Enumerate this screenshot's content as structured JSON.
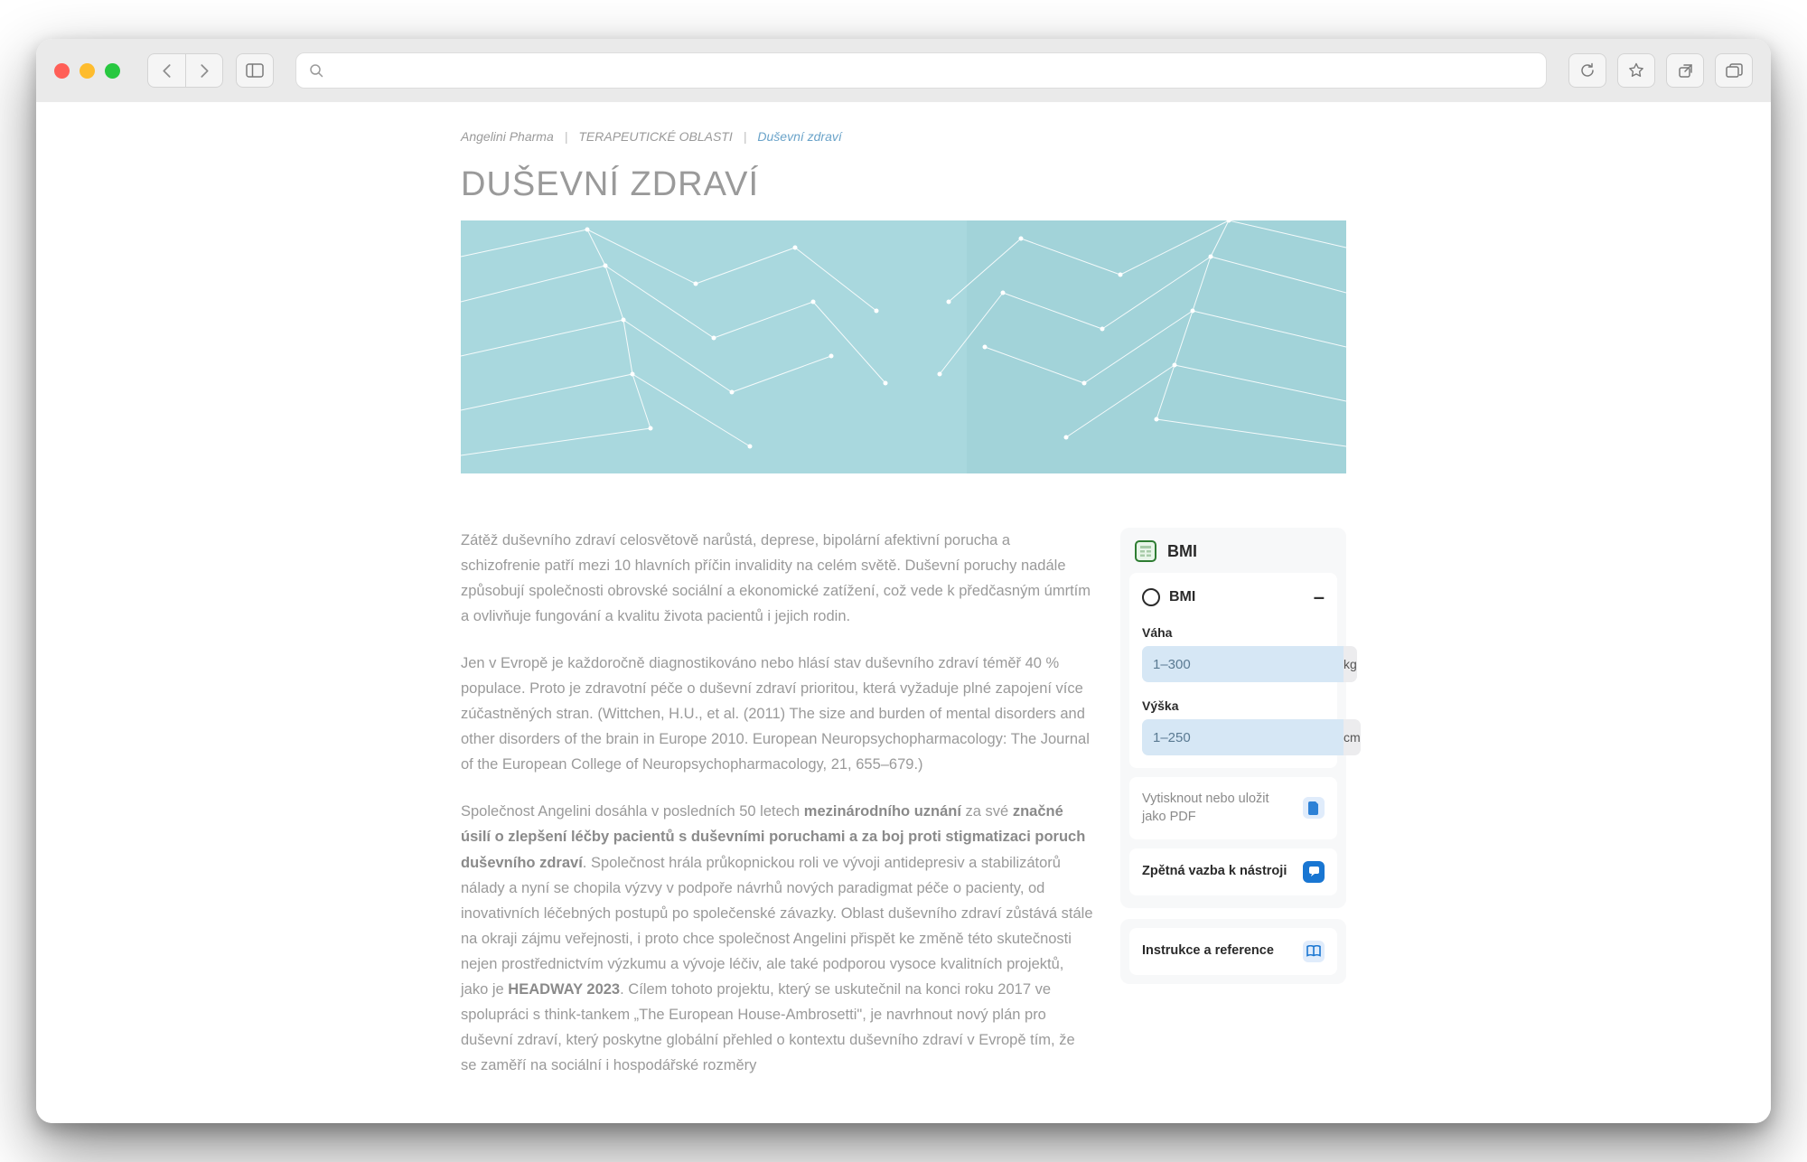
{
  "breadcrumb": {
    "items": [
      "Angelini Pharma",
      "TERAPEUTICKÉ OBLASTI",
      "Duševní zdraví"
    ]
  },
  "page": {
    "title": "DUŠEVNÍ ZDRAVÍ"
  },
  "article": {
    "p1": "Zátěž duševního zdraví celosvětově narůstá, deprese, bipolární afektivní porucha a schizofrenie patří mezi 10 hlavních příčin invalidity na celém světě. Duševní poruchy nadále způsobují společnosti obrovské sociální a ekonomické zatížení, což vede k předčasným úmrtím a ovlivňuje fungování a kvalitu života pacientů i jejich rodin.",
    "p2": "Jen v Evropě je každoročně diagnostikováno nebo hlásí stav duševního zdraví téměř 40 % populace. Proto je zdravotní péče o duševní zdraví prioritou, která vyžaduje plné zapojení více zúčastněných stran. (Wittchen, H.U., et al. (2011) The size and burden of mental disorders and other disorders of the brain in Europe 2010. European Neuropsychopharmacology: The Journal of the European College of Neuropsychopharmacology, 21, 655–679.)",
    "p3a": "Společnost Angelini dosáhla v posledních 50 letech ",
    "p3b": "mezinárodního uznání",
    "p3c": " za své ",
    "p3d": "značné úsilí o zlepšení léčby pacientů s duševními poruchami a za boj proti stigmatizaci poruch duševního zdraví",
    "p3e": ". Společnost hrála průkopnickou roli ve vývoji antidepresiv a stabilizátorů nálady a nyní se chopila výzvy v podpoře návrhů nových paradigmat péče o pacienty, od inovativních léčebných postupů po společenské závazky. Oblast duševního zdraví zůstává stále na okraji zájmu veřejnosti, i proto chce společnost Angelini přispět ke změně této skutečnosti nejen prostřednictvím výzkumu a vývoje léčiv, ale také podporou vysoce kvalitních projektů, jako je ",
    "p3f": "HEADWAY 2023",
    "p3g": ". Cílem tohoto projektu, který se uskutečnil na konci roku 2017 ve spolupráci s think-tankem „The European House-Ambrosetti\", je navrhnout nový plán pro duševní zdraví, který poskytne globální přehled o kontextu duševního zdraví v Evropě tím, že se zaměří na sociální i hospodářské rozměry"
  },
  "sidebar": {
    "calc": {
      "title": "BMI",
      "section_label": "BMI",
      "fields": {
        "weight": {
          "label": "Váha",
          "placeholder": "1–300",
          "unit": "kg"
        },
        "height": {
          "label": "Výška",
          "placeholder": "1–250",
          "unit": "cm"
        }
      }
    },
    "actions": {
      "print": "Vytisknout nebo uložit jako PDF",
      "feedback": "Zpětná vazba k nástroji",
      "instructions": "Instrukce a reference"
    }
  }
}
